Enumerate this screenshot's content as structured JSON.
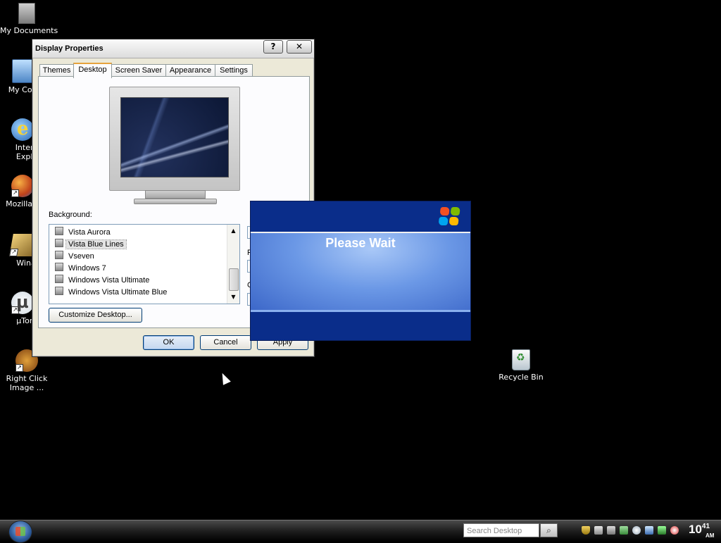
{
  "desktop": {
    "icons": [
      {
        "label": "My Documents",
        "icon": "documents-icon"
      },
      {
        "label": "My Com",
        "icon": "computer-icon"
      },
      {
        "label": "Intern",
        "label2": "Explo",
        "icon": "internet-explorer-icon"
      },
      {
        "label": "Mozilla F",
        "icon": "firefox-icon"
      },
      {
        "label": "Wina",
        "icon": "winamp-icon"
      },
      {
        "label": "µTorr",
        "icon": "utorrent-icon"
      },
      {
        "label": "Right Click",
        "label2": "Image ...",
        "icon": "right-click-image-icon"
      },
      {
        "label": "Recycle Bin",
        "icon": "recycle-bin-icon"
      }
    ]
  },
  "window": {
    "title": "Display Properties",
    "help_button": "?",
    "close_button": "✕",
    "tabs": [
      {
        "label": "Themes"
      },
      {
        "label": "Desktop"
      },
      {
        "label": "Screen Saver"
      },
      {
        "label": "Appearance"
      },
      {
        "label": "Settings"
      }
    ],
    "active_tab": "Desktop",
    "background_label": "Background:",
    "backgrounds": [
      {
        "label": "Vista Aurora"
      },
      {
        "label": "Vista Blue Lines"
      },
      {
        "label": "Vseven"
      },
      {
        "label": "Windows 7"
      },
      {
        "label": "Windows Vista Ultimate"
      },
      {
        "label": "Windows Vista Ultimate Blue"
      }
    ],
    "selected_background": "Vista Blue Lines",
    "customize_button": "Customize Desktop...",
    "partial_labels": {
      "p": "P",
      "c": "C"
    },
    "ok_button": "OK",
    "cancel_button": "Cancel",
    "apply_button": "Apply"
  },
  "please_wait": {
    "message": "Please Wait",
    "logo_colors": [
      "#f25022",
      "#7fba00",
      "#00a4ef",
      "#ffb900"
    ]
  },
  "taskbar": {
    "search_placeholder": "Search Desktop",
    "search_icon": "magnifier-icon",
    "clock_hour": "10",
    "clock_minutes": "41",
    "clock_ampm": "AM",
    "tray_icons": [
      "shield-icon",
      "network-icon",
      "volume-icon",
      "connection-icon",
      "search-icon",
      "flag-icon",
      "security-icon",
      "stop-icon"
    ]
  }
}
